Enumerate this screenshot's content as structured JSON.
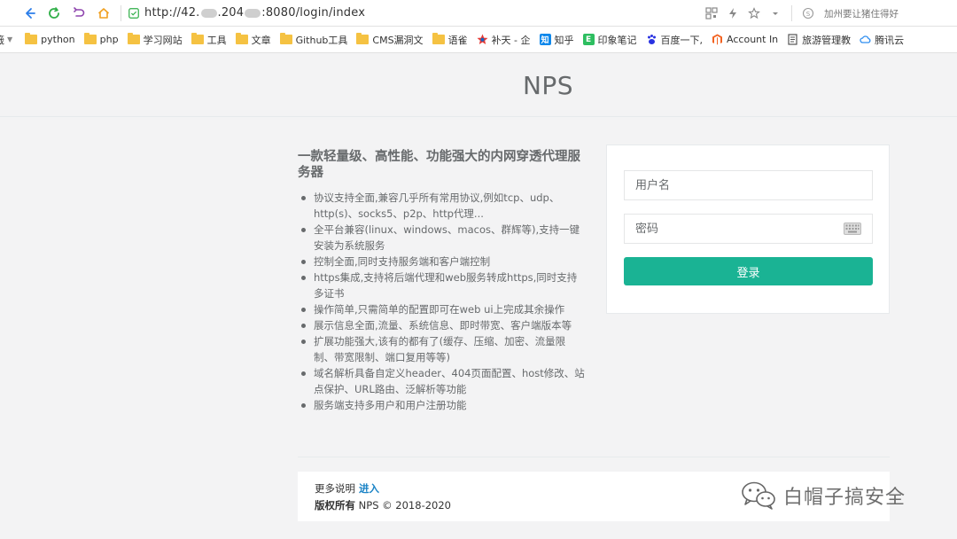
{
  "browser": {
    "url_prefix": "http://42.",
    "url_mid": ".204",
    "url_suffix": ":8080/login/index",
    "search_hint": "加州要让猪住得好"
  },
  "bookmarks": [
    {
      "label": "python",
      "icon": "folder-icon"
    },
    {
      "label": "php",
      "icon": "folder-icon"
    },
    {
      "label": "学习网站",
      "icon": "folder-icon"
    },
    {
      "label": "工具",
      "icon": "folder-icon"
    },
    {
      "label": "文章",
      "icon": "folder-icon"
    },
    {
      "label": "Github工具",
      "icon": "folder-icon"
    },
    {
      "label": "CMS漏洞文",
      "icon": "folder-icon"
    },
    {
      "label": "语雀",
      "icon": "folder-icon"
    },
    {
      "label": "补天 - 企",
      "icon": "butian-icon"
    },
    {
      "label": "知乎",
      "icon": "zhihu-icon"
    },
    {
      "label": "印象笔记",
      "icon": "evernote-icon"
    },
    {
      "label": "百度一下,",
      "icon": "baidu-icon"
    },
    {
      "label": "Account In",
      "icon": "magento-icon"
    },
    {
      "label": "旅游管理教",
      "icon": "doc-icon"
    },
    {
      "label": "腾讯云",
      "icon": "cloud-icon"
    }
  ],
  "page": {
    "title": "NPS",
    "intro_heading": "一款轻量级、高性能、功能强大的内网穿透代理服务器",
    "features": [
      "协议支持全面,兼容几乎所有常用协议,例如tcp、udp、http(s)、socks5、p2p、http代理...",
      "全平台兼容(linux、windows、macos、群辉等),支持一键安装为系统服务",
      "控制全面,同时支持服务端和客户端控制",
      "https集成,支持将后端代理和web服务转成https,同时支持多证书",
      "操作简单,只需简单的配置即可在web ui上完成其余操作",
      "展示信息全面,流量、系统信息、即时带宽、客户端版本等",
      "扩展功能强大,该有的都有了(缓存、压缩、加密、流量限制、带宽限制、端口复用等等)",
      "域名解析具备自定义header、404页面配置、host修改、站点保护、URL路由、泛解析等功能",
      "服务端支持多用户和用户注册功能"
    ]
  },
  "login": {
    "username_placeholder": "用户名",
    "password_placeholder": "密码",
    "submit_label": "登录"
  },
  "footer": {
    "more_label": "更多说明",
    "more_link": "进入",
    "copyright_bold": "版权所有",
    "copyright_rest": " NPS © 2018-2020"
  },
  "watermark": {
    "text": "白帽子搞安全"
  },
  "colors": {
    "accent": "#1ab394",
    "link": "#1c84c6",
    "text": "#676a6c",
    "page_bg": "#f3f3f4"
  }
}
